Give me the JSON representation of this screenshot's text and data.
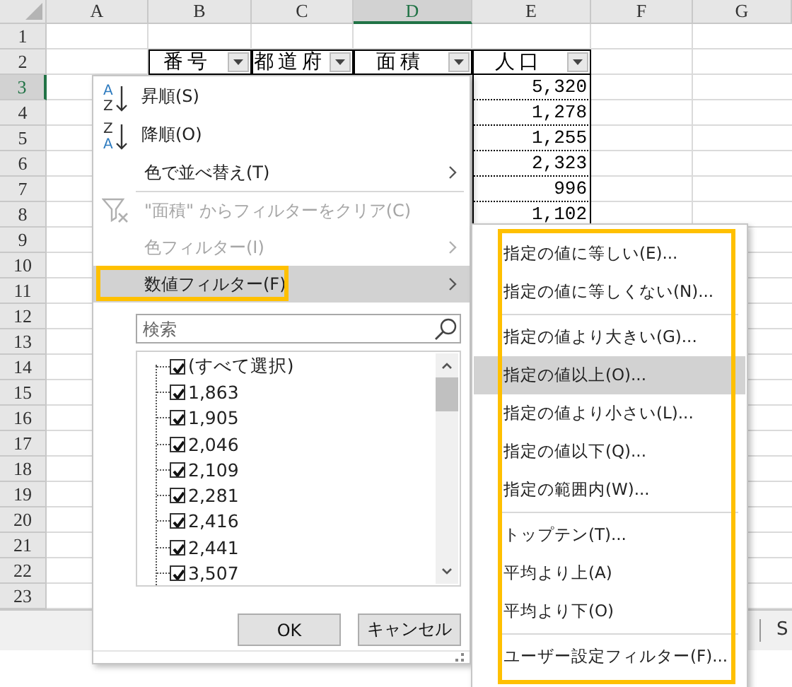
{
  "sheet": {
    "columns": [
      {
        "label": "A",
        "selected": false
      },
      {
        "label": "B",
        "selected": false
      },
      {
        "label": "C",
        "selected": false
      },
      {
        "label": "D",
        "selected": true
      },
      {
        "label": "E",
        "selected": false
      },
      {
        "label": "F",
        "selected": false
      },
      {
        "label": "G",
        "selected": false
      }
    ],
    "rows": [
      {
        "label": "1",
        "selected": false
      },
      {
        "label": "2",
        "selected": false
      },
      {
        "label": "3",
        "selected": true
      },
      {
        "label": "4",
        "selected": false
      },
      {
        "label": "5",
        "selected": false
      },
      {
        "label": "6",
        "selected": false
      },
      {
        "label": "7",
        "selected": false
      },
      {
        "label": "8",
        "selected": false
      },
      {
        "label": "9",
        "selected": false
      },
      {
        "label": "10",
        "selected": false
      },
      {
        "label": "11",
        "selected": false
      },
      {
        "label": "12",
        "selected": false
      },
      {
        "label": "13",
        "selected": false
      },
      {
        "label": "14",
        "selected": false
      },
      {
        "label": "15",
        "selected": false
      },
      {
        "label": "16",
        "selected": false
      },
      {
        "label": "17",
        "selected": false
      },
      {
        "label": "18",
        "selected": false
      },
      {
        "label": "19",
        "selected": false
      },
      {
        "label": "20",
        "selected": false
      },
      {
        "label": "21",
        "selected": false
      },
      {
        "label": "22",
        "selected": false
      },
      {
        "label": "23",
        "selected": false
      }
    ],
    "headers": [
      "番号",
      "都道府",
      "面積",
      "人口"
    ],
    "values": [
      "5,320",
      "1,278",
      "1,255",
      "2,323",
      "996",
      "1,102"
    ],
    "sheet_tab": "S"
  },
  "filter_menu": {
    "items": [
      {
        "kind": "sort-asc",
        "icon_letters": [
          "A",
          "Z"
        ],
        "label": "昇順(S)",
        "disabled": false,
        "highlighted": false
      },
      {
        "kind": "sort-desc",
        "icon_letters": [
          "Z",
          "A"
        ],
        "label": "降順(O)",
        "disabled": false,
        "highlighted": false
      },
      {
        "kind": "submenu",
        "label": "色で並べ替え(T)",
        "disabled": false,
        "highlighted": false
      },
      {
        "kind": "separator"
      },
      {
        "kind": "clear",
        "label": "\"面積\" からフィルターをクリア(C)",
        "disabled": true,
        "highlighted": false
      },
      {
        "kind": "submenu",
        "label": "色フィルター(I)",
        "disabled": true,
        "highlighted": false
      },
      {
        "kind": "submenu",
        "label": "数値フィルター(F)",
        "disabled": false,
        "highlighted": true
      }
    ],
    "search": {
      "placeholder": "検索"
    },
    "values": [
      {
        "label": "(すべて選択)",
        "checked": true
      },
      {
        "label": "1,863",
        "checked": true
      },
      {
        "label": "1,905",
        "checked": true
      },
      {
        "label": "2,046",
        "checked": true
      },
      {
        "label": "2,109",
        "checked": true
      },
      {
        "label": "2,281",
        "checked": true
      },
      {
        "label": "2,416",
        "checked": true
      },
      {
        "label": "2,441",
        "checked": true
      },
      {
        "label": "3,507",
        "checked": true
      }
    ],
    "buttons": [
      "OK",
      "キャンセル"
    ]
  },
  "submenu": {
    "items": [
      {
        "kind": "option",
        "label": "指定の値に等しい(E)...",
        "highlighted": false
      },
      {
        "kind": "option",
        "label": "指定の値に等しくない(N)...",
        "highlighted": false
      },
      {
        "kind": "separator"
      },
      {
        "kind": "option",
        "label": "指定の値より大きい(G)...",
        "highlighted": false
      },
      {
        "kind": "option",
        "label": "指定の値以上(O)...",
        "highlighted": true
      },
      {
        "kind": "option",
        "label": "指定の値より小さい(L)...",
        "highlighted": false
      },
      {
        "kind": "option",
        "label": "指定の値以下(Q)...",
        "highlighted": false
      },
      {
        "kind": "option",
        "label": "指定の範囲内(W)...",
        "highlighted": false
      },
      {
        "kind": "separator"
      },
      {
        "kind": "option",
        "label": "トップテン(T)...",
        "highlighted": false
      },
      {
        "kind": "option",
        "label": "平均より上(A)",
        "highlighted": false
      },
      {
        "kind": "option",
        "label": "平均より下(O)",
        "highlighted": false
      },
      {
        "kind": "separator"
      },
      {
        "kind": "option",
        "label": "ユーザー設定フィルター(F)...",
        "highlighted": false
      }
    ]
  }
}
